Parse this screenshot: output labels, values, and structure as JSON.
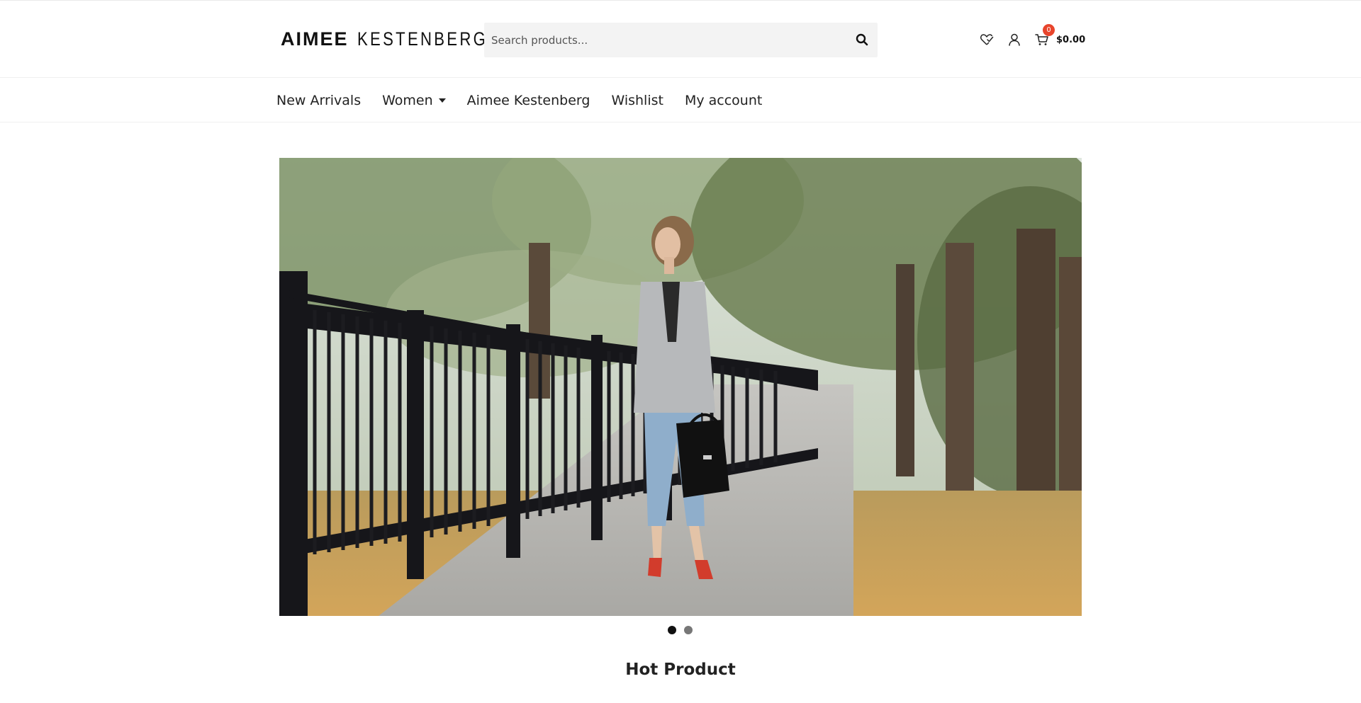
{
  "brand": {
    "logo_part1": "AIMEE",
    "logo_part2": "KESTENBERG"
  },
  "search": {
    "placeholder": "Search products...",
    "icon": "search-icon"
  },
  "header_icons": {
    "wishlist_icon": "heart-icon",
    "account_icon": "user-icon",
    "cart_icon": "cart-icon",
    "cart_count": "0",
    "cart_total": "$0.00"
  },
  "nav": {
    "items": [
      {
        "label": "New Arrivals"
      },
      {
        "label": "Women",
        "has_dropdown": true
      },
      {
        "label": "Aimee Kestenberg"
      },
      {
        "label": "Wishlist"
      },
      {
        "label": "My account"
      }
    ]
  },
  "slider": {
    "slide_count": 2,
    "active_index": 0
  },
  "sections": {
    "hot_product_title": "Hot Product"
  },
  "colors": {
    "badge": "#e8452c",
    "search_bg": "#f3f3f3",
    "text": "#222222"
  }
}
